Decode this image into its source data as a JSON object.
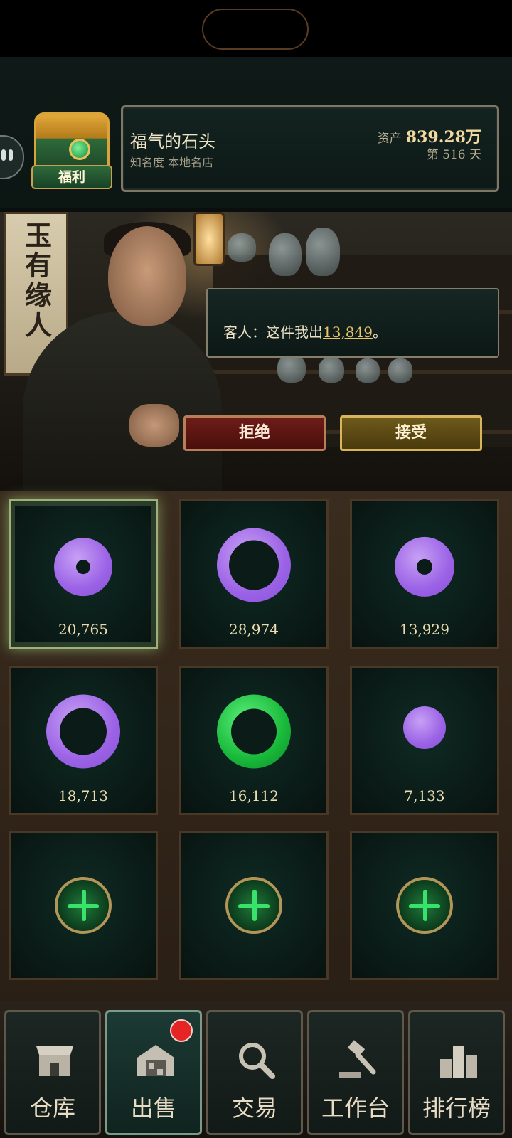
{
  "header": {
    "welfare_label": "福利",
    "shop_name": "福气的石头",
    "fame_label": "知名度",
    "fame_value": "本地名店",
    "asset_label": "资产",
    "asset_value": "839.28万",
    "day_prefix": "第",
    "day_number": "516",
    "day_suffix": "天"
  },
  "scene": {
    "scroll_text": "玉有缘人",
    "dialog_prefix": "客人：这件我出",
    "dialog_price": "13,849",
    "dialog_suffix": "。",
    "reject_label": "拒绝",
    "accept_label": "接受"
  },
  "items": [
    {
      "price": "20,765",
      "color": "purple",
      "shape": "disc",
      "selected": true
    },
    {
      "price": "28,974",
      "color": "purple",
      "shape": "ring"
    },
    {
      "price": "13,929",
      "color": "purple",
      "shape": "disc"
    },
    {
      "price": "18,713",
      "color": "purple",
      "shape": "ring"
    },
    {
      "price": "16,112",
      "color": "green",
      "shape": "ring"
    },
    {
      "price": "7,133",
      "color": "purple",
      "shape": "bead"
    },
    {
      "empty": true
    },
    {
      "empty": true
    },
    {
      "empty": true
    }
  ],
  "tabs": [
    {
      "label": "仓库",
      "icon": "shop-icon"
    },
    {
      "label": "出售",
      "icon": "warehouse-icon",
      "active": true,
      "badge": true
    },
    {
      "label": "交易",
      "icon": "magnifier-icon"
    },
    {
      "label": "工作台",
      "icon": "hammer-icon"
    },
    {
      "label": "排行榜",
      "icon": "podium-icon"
    }
  ],
  "colors": {
    "jade_purple": "#9b62e6",
    "jade_green": "#18b83a",
    "price_highlight": "#e8c56a",
    "badge_red": "#e52424"
  }
}
